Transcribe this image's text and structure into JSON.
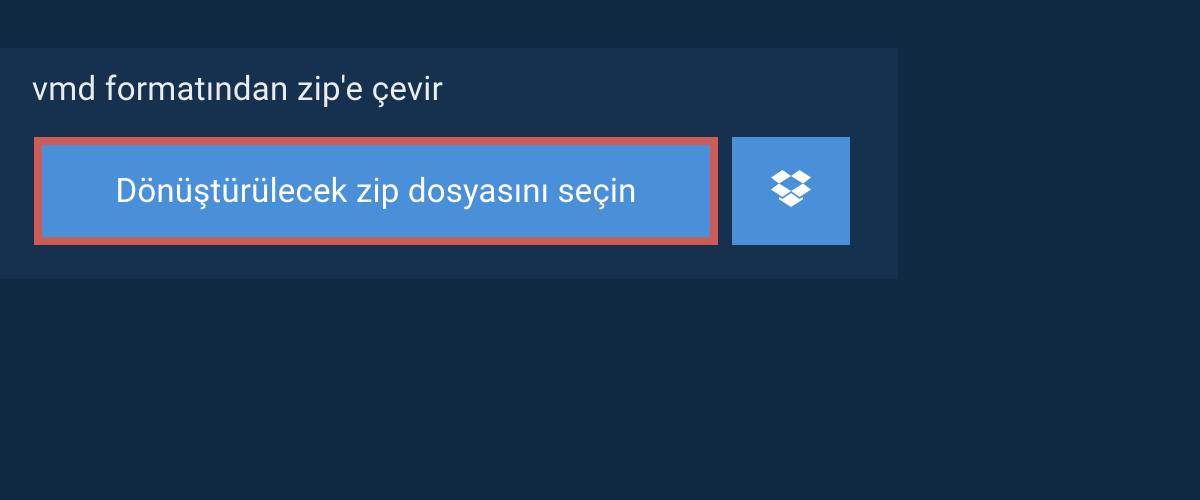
{
  "panel": {
    "title": "vmd formatından zip'e çevir",
    "select_file_label": "Dönüştürülecek zip dosyasını seçin"
  },
  "colors": {
    "page_bg": "#0f2940",
    "panel_bg": "#15314d",
    "button_bg": "#4a90d9",
    "highlight_border": "#cd5b57",
    "text": "#e8edf2"
  }
}
